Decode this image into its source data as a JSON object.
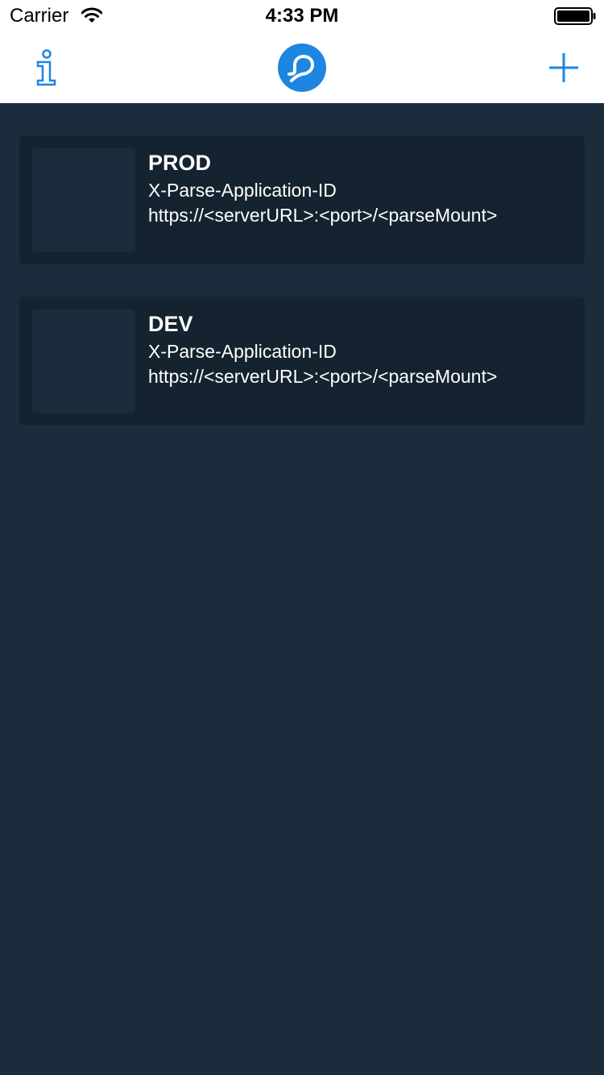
{
  "status_bar": {
    "carrier": "Carrier",
    "time": "4:33 PM",
    "icons": [
      "wifi-icon",
      "battery-icon"
    ]
  },
  "nav": {
    "left_icon": "info-icon",
    "center_icon": "parse-logo-icon",
    "right_icon": "plus-icon",
    "accent_color": "#1d86e0"
  },
  "apps": [
    {
      "name": "PROD",
      "app_id": "X-Parse-Application-ID",
      "server_url": "https://<serverURL>:<port>/<parseMount>"
    },
    {
      "name": "DEV",
      "app_id": "X-Parse-Application-ID",
      "server_url": "https://<serverURL>:<port>/<parseMount>"
    }
  ],
  "colors": {
    "background": "#1b2d3c",
    "card": "#152330",
    "text": "#ffffff"
  }
}
